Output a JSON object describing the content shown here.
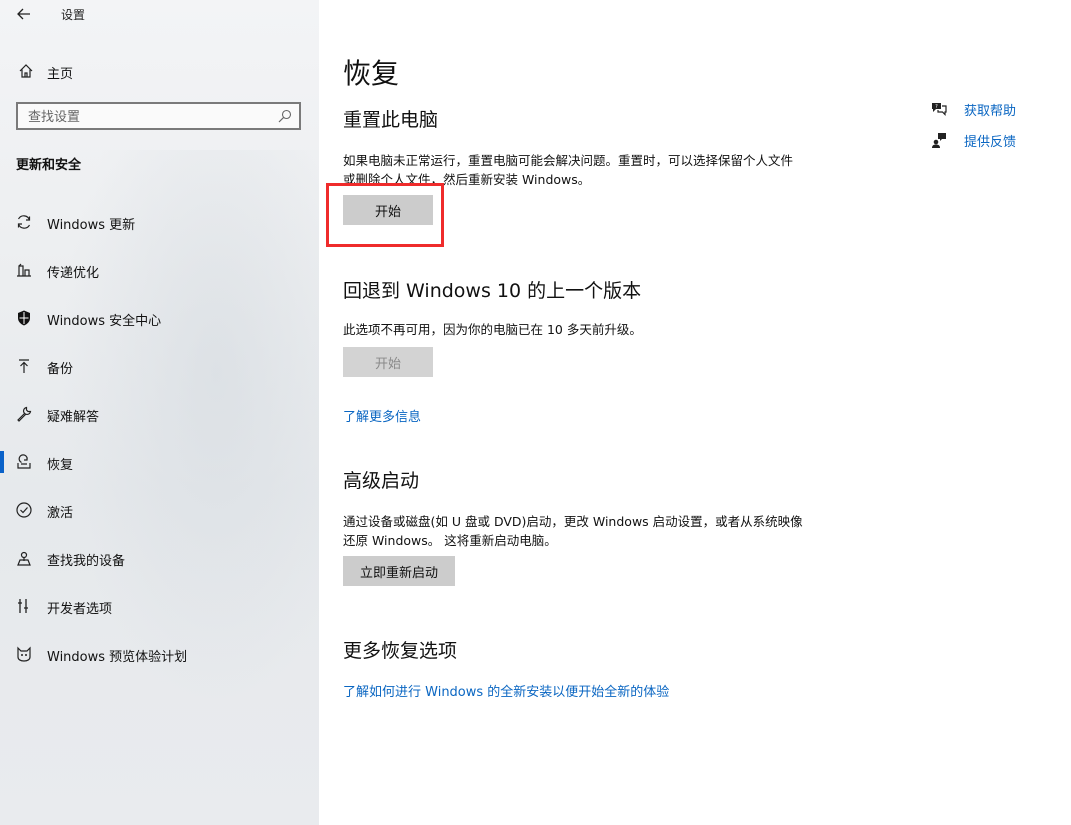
{
  "window": {
    "title": "设置"
  },
  "sidebar": {
    "home_label": "主页",
    "search_placeholder": "查找设置",
    "section_title": "更新和安全",
    "items": [
      {
        "label": "Windows 更新",
        "icon": "refresh-icon"
      },
      {
        "label": "传递优化",
        "icon": "delivery-optimization-icon"
      },
      {
        "label": "Windows 安全中心",
        "icon": "shield-icon"
      },
      {
        "label": "备份",
        "icon": "backup-arrow-icon"
      },
      {
        "label": "疑难解答",
        "icon": "wrench-icon"
      },
      {
        "label": "恢复",
        "icon": "recovery-icon",
        "selected": true
      },
      {
        "label": "激活",
        "icon": "check-circle-icon"
      },
      {
        "label": "查找我的设备",
        "icon": "find-device-icon"
      },
      {
        "label": "开发者选项",
        "icon": "developer-tools-icon"
      },
      {
        "label": "Windows 预览体验计划",
        "icon": "insider-cat-icon"
      }
    ]
  },
  "main": {
    "title": "恢复",
    "reset": {
      "heading": "重置此电脑",
      "description": "如果电脑未正常运行，重置电脑可能会解决问题。重置时，可以选择保留个人文件或删除个人文件，然后重新安装 Windows。",
      "button": "开始"
    },
    "rollback": {
      "heading": "回退到 Windows 10 的上一个版本",
      "description": "此选项不再可用，因为你的电脑已在 10 多天前升级。",
      "button": "开始",
      "link": "了解更多信息"
    },
    "advanced": {
      "heading": "高级启动",
      "description": "通过设备或磁盘(如 U 盘或 DVD)启动，更改 Windows 启动设置，或者从系统映像还原 Windows。 这将重新启动电脑。",
      "button": "立即重新启动"
    },
    "more": {
      "heading": "更多恢复选项",
      "link": "了解如何进行 Windows 的全新安装以便开始全新的体验"
    }
  },
  "help": {
    "get_help": "获取帮助",
    "feedback": "提供反馈"
  },
  "colors": {
    "accent": "#0a62c9",
    "link": "#0a66c2",
    "highlight": "#ef2b2b",
    "button": "#cccccc"
  }
}
